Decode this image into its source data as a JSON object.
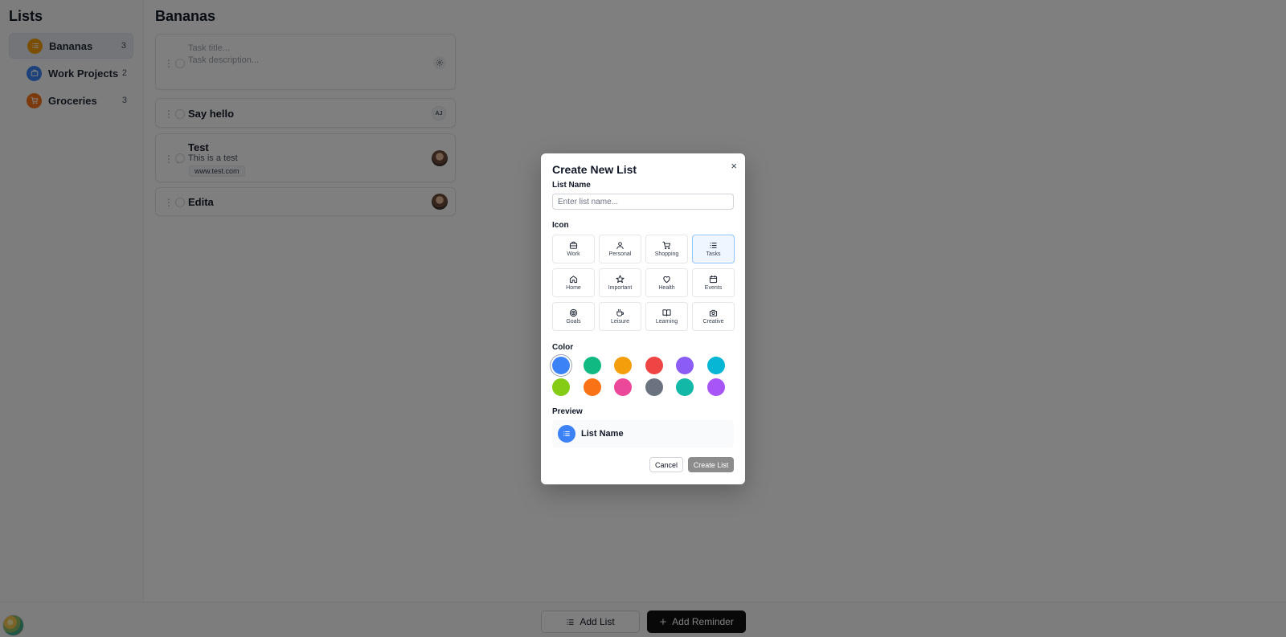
{
  "sidebar": {
    "title": "Lists",
    "items": [
      {
        "label": "Bananas",
        "count": "3",
        "color": "#f59e0b",
        "icon": "list-icon"
      },
      {
        "label": "Work Projects",
        "count": "2",
        "color": "#3b82f6",
        "icon": "briefcase-icon"
      },
      {
        "label": "Groceries",
        "count": "3",
        "color": "#f97316",
        "icon": "cart-icon"
      }
    ]
  },
  "main": {
    "title": "Bananas",
    "new_task": {
      "title_placeholder": "Task title...",
      "description_placeholder": "Task description..."
    },
    "tasks": [
      {
        "title": "Say hello",
        "assignee": "AJ"
      },
      {
        "title": "Test",
        "description": "This is a test",
        "link": "www.test.com"
      },
      {
        "title": "Edita"
      }
    ]
  },
  "bottom_bar": {
    "add_list": "Add List",
    "add_reminder": "Add Reminder"
  },
  "modal": {
    "title": "Create New List",
    "close": "×",
    "name_label": "List Name",
    "name_placeholder": "Enter list name...",
    "icon_label": "Icon",
    "icons": [
      {
        "label": "Work",
        "icon": "briefcase-icon"
      },
      {
        "label": "Personal",
        "icon": "user-icon"
      },
      {
        "label": "Shopping",
        "icon": "cart-icon"
      },
      {
        "label": "Tasks",
        "icon": "list-icon",
        "selected": true
      },
      {
        "label": "Home",
        "icon": "home-icon"
      },
      {
        "label": "Important",
        "icon": "star-icon"
      },
      {
        "label": "Health",
        "icon": "heart-icon"
      },
      {
        "label": "Events",
        "icon": "calendar-icon"
      },
      {
        "label": "Goals",
        "icon": "target-icon"
      },
      {
        "label": "Leisure",
        "icon": "coffee-icon"
      },
      {
        "label": "Learning",
        "icon": "book-icon"
      },
      {
        "label": "Creative",
        "icon": "camera-icon"
      }
    ],
    "color_label": "Color",
    "colors": [
      "#3b82f6",
      "#10b981",
      "#f59e0b",
      "#ef4444",
      "#8b5cf6",
      "#06b6d4",
      "#84cc16",
      "#f97316",
      "#ec4899",
      "#6b7280",
      "#14b8a6",
      "#a855f7"
    ],
    "selected_color": "#3b82f6",
    "preview_label": "Preview",
    "preview_name": "List Name",
    "cancel": "Cancel",
    "create": "Create List"
  }
}
